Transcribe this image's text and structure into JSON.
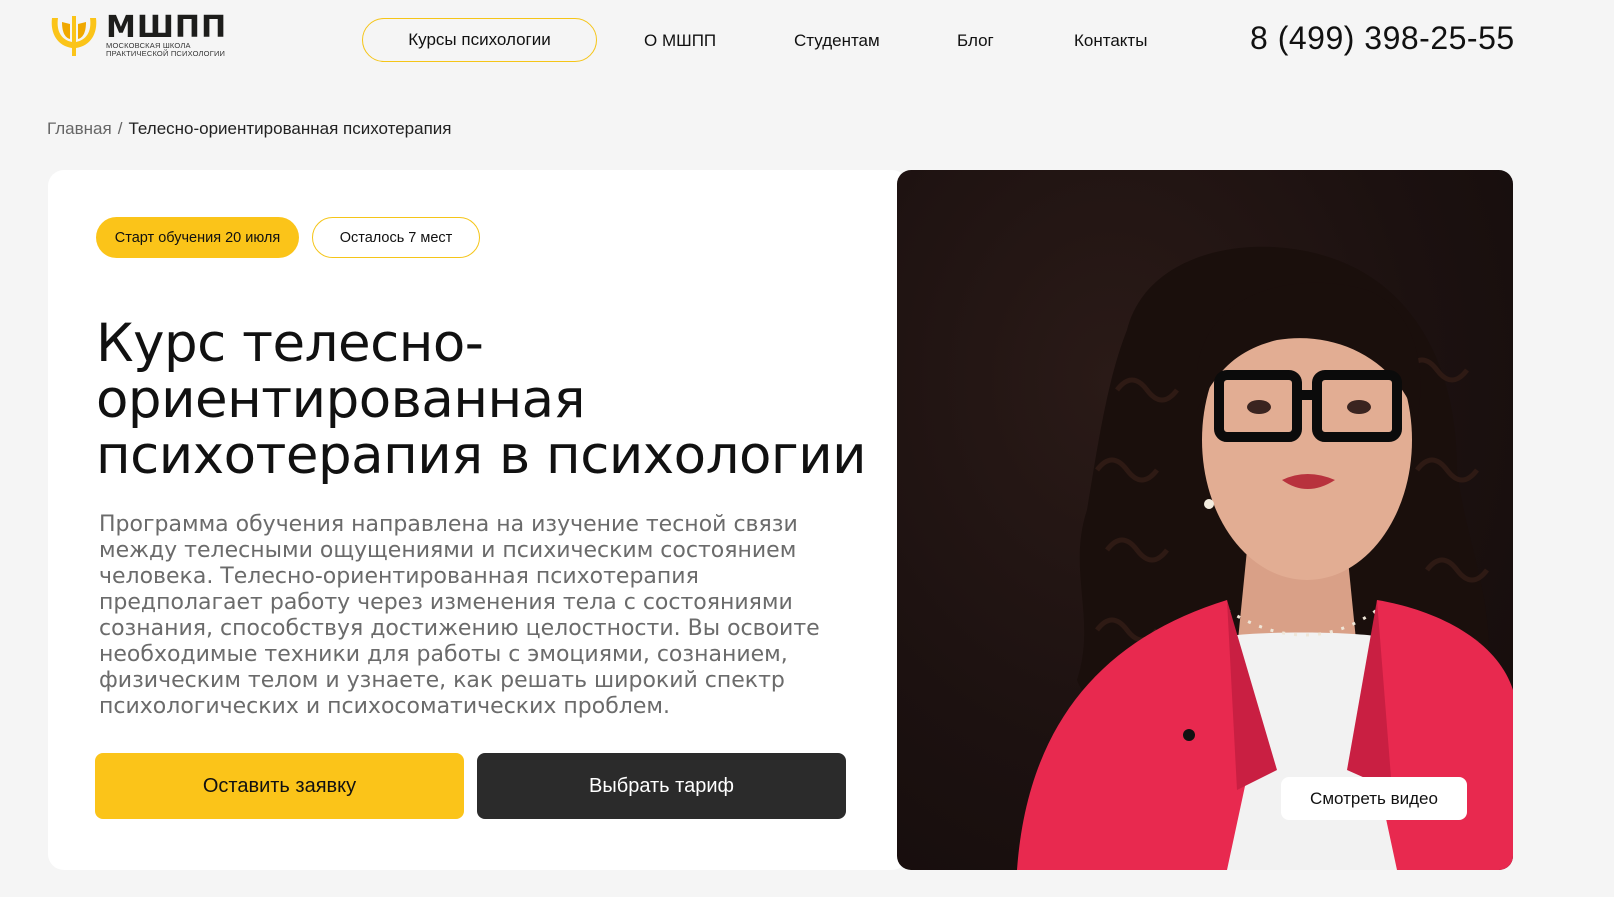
{
  "brand": {
    "name": "МШПП",
    "subtitle_line1": "Московская школа",
    "subtitle_line2": "практической психологии",
    "accent_color": "#fbc419",
    "dark_color": "#2b2b2b"
  },
  "nav": {
    "courses": "Курсы психологии",
    "about": "О МШПП",
    "students": "Студентам",
    "blog": "Блог",
    "contacts": "Контакты"
  },
  "phone": "8 (499) 398-25-55",
  "breadcrumb": {
    "home": "Главная",
    "separator": "/",
    "current": "Телесно-ориентированная психотерапия"
  },
  "hero": {
    "chip_start": "Старт обучения 20 июля",
    "chip_seats": "Осталось 7 мест",
    "title_line1": "Курс телесно-",
    "title_line2": "ориентированная",
    "title_line3": "психотерапия в психологии",
    "description": "Программа обучения направлена на изучение тесной связи между телесными ощущениями и психическим состоянием человека. Телесно-ориентированная психотерапия предполагает работу через изменения тела с состояниями сознания, способствуя достижению целостности. Вы освоите необходимые техники для работы с эмоциями, сознанием, физическим телом и узнаете, как решать широкий спектр психологических и психосоматических проблем.",
    "btn_apply": "Оставить заявку",
    "btn_tariff": "Выбрать тариф"
  },
  "video": {
    "watch_label": "Смотреть видео",
    "jacket_color": "#e8294f"
  }
}
